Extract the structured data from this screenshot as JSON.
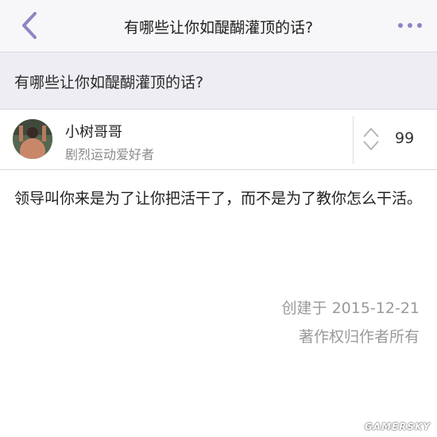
{
  "navbar": {
    "back_icon": "chevron-left-icon",
    "title": "有哪些让你如醍醐灌顶的话?",
    "more_icon": "more-dots-icon"
  },
  "question": {
    "title": "有哪些让你如醍醐灌顶的话?"
  },
  "author": {
    "name": "小树哥哥",
    "bio": "剧烈运动爱好者"
  },
  "vote": {
    "icon": "vote-arrows-icon",
    "count": "99"
  },
  "answer": {
    "text": "领导叫你来是为了让你把活干了，而不是为了教你怎么干活。"
  },
  "meta": {
    "created": "创建于 2015-12-21",
    "copyright": "著作权归作者所有"
  },
  "watermark": "GAMERSKY",
  "colors": {
    "accent": "#8e84c4",
    "question_bg": "#eeedf4",
    "meta_text": "#9a9a9a"
  }
}
